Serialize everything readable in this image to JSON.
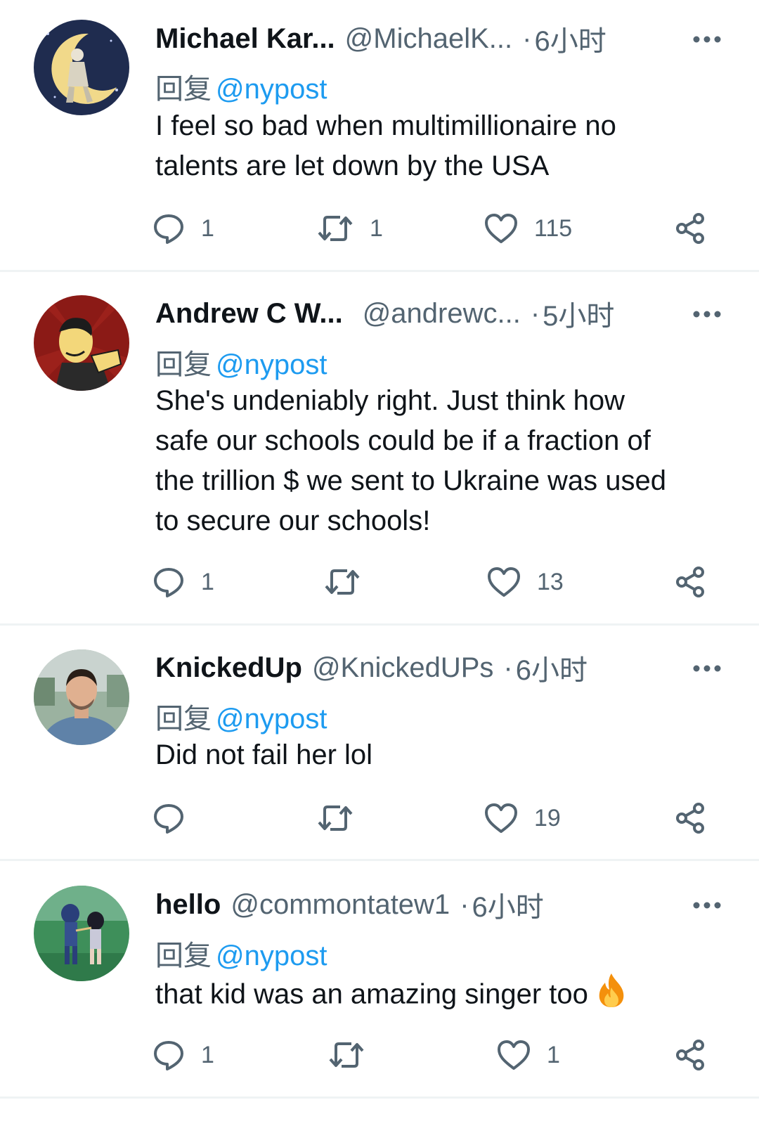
{
  "tweets": [
    {
      "name": "Michael Kar...",
      "handle": "@MichaelK...",
      "dot": "·",
      "time": "6小时",
      "reply_prefix": "回复",
      "reply_to": "@nypost",
      "text_lines": [
        "I feel so bad when multimillionaire no",
        "talents are let down by the USA"
      ],
      "replies": "1",
      "retweets": "1",
      "likes": "115"
    },
    {
      "name": "Andrew C W...",
      "handle": "@andrewc...",
      "dot": "·",
      "time": "5小时",
      "reply_prefix": "回复",
      "reply_to": "@nypost",
      "text_lines": [
        "She's undeniably right. Just think how",
        "safe our schools could be if a fraction of",
        "the trillion $ we sent to Ukraine was used",
        "to secure our schools!"
      ],
      "replies": "1",
      "retweets": "",
      "likes": "13"
    },
    {
      "name": "KnickedUp",
      "handle": "@KnickedUPs",
      "dot": "·",
      "time": "6小时",
      "reply_prefix": "回复",
      "reply_to": "@nypost",
      "text_lines": [
        "Did not fail her lol"
      ],
      "replies": "",
      "retweets": "",
      "likes": "19"
    },
    {
      "name": "hello",
      "handle": "@commontatew1",
      "dot": "·",
      "time": "6小时",
      "reply_prefix": "回复",
      "reply_to": "@nypost",
      "text_lines": [
        "that kid was an amazing singer too"
      ],
      "text_emoji": "fire-emoji",
      "replies": "1",
      "retweets": "",
      "likes": "1"
    }
  ],
  "colors": {
    "text": "#0f1419",
    "muted": "#536471",
    "link": "#1d9bf0",
    "divider": "#eff3f4"
  },
  "icons": {
    "reply": "comment-bubble-icon",
    "retweet": "retweet-icon",
    "like": "heart-icon",
    "share": "share-icon",
    "more": "more-dots-icon"
  }
}
